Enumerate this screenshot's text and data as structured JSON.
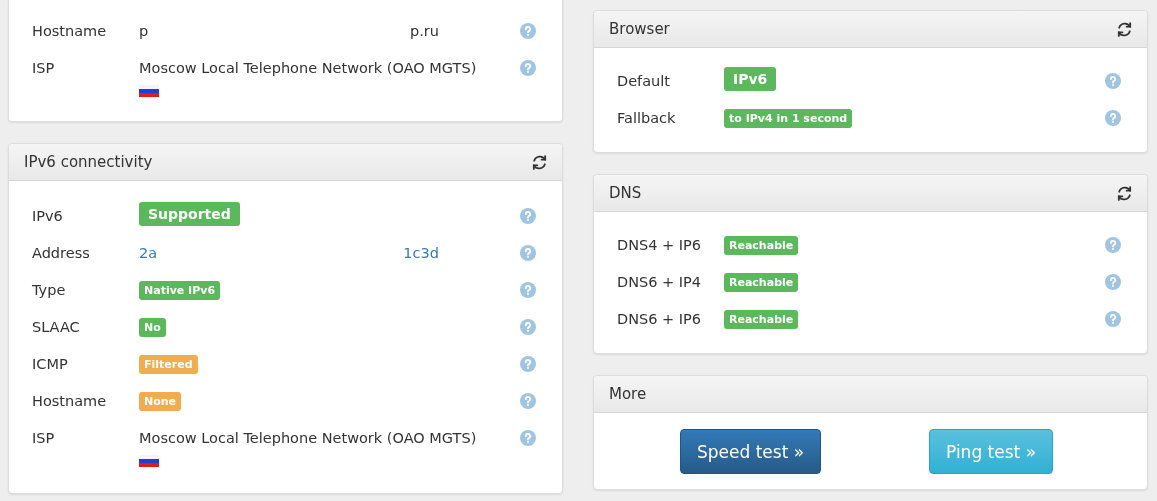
{
  "left": [
    {
      "cut_top": true,
      "rows": [
        {
          "label": "Hostname",
          "kind": "redacted",
          "parts": [
            "p",
            "p.ru"
          ]
        },
        {
          "label": "ISP",
          "kind": "text",
          "value": "Moscow Local Telephone Network (OAO MGTS)",
          "flag": true
        }
      ]
    },
    {
      "title": "IPv6 connectivity",
      "cut_top": false,
      "rows": [
        {
          "label": "IPv6",
          "kind": "large_badge",
          "value": "Supported",
          "color": "#5cb85c"
        },
        {
          "label": "Address",
          "kind": "redacted_link",
          "parts": [
            "2a",
            "1c3d"
          ]
        },
        {
          "label": "Type",
          "kind": "badge",
          "value": "Native IPv6",
          "color": "#5cb85c"
        },
        {
          "label": "SLAAC",
          "kind": "badge",
          "value": "No",
          "color": "#5cb85c"
        },
        {
          "label": "ICMP",
          "kind": "badge",
          "value": "Filtered",
          "color": "#f0ad4e"
        },
        {
          "label": "Hostname",
          "kind": "badge",
          "value": "None",
          "color": "#f0ad4e"
        },
        {
          "label": "ISP",
          "kind": "text",
          "value": "Moscow Local Telephone Network (OAO MGTS)",
          "flag": true
        }
      ]
    }
  ],
  "right": [
    {
      "title": "Browser",
      "cut_top": false,
      "rows": [
        {
          "label": "Default",
          "kind": "large_badge",
          "value": "IPv6",
          "color": "#5cb85c"
        },
        {
          "label": "Fallback",
          "kind": "badge",
          "value": "to IPv4 in 1 second",
          "color": "#5cb85c"
        }
      ]
    },
    {
      "title": "DNS",
      "cut_top": false,
      "rows": [
        {
          "label": "DNS4 + IP6",
          "kind": "badge",
          "value": "Reachable",
          "color": "#5cb85c"
        },
        {
          "label": "DNS6 + IP4",
          "kind": "badge",
          "value": "Reachable",
          "color": "#5cb85c"
        },
        {
          "label": "DNS6 + IP6",
          "kind": "badge",
          "value": "Reachable",
          "color": "#5cb85c"
        }
      ]
    }
  ],
  "more": {
    "title": "More",
    "buttons": [
      {
        "label": "Speed test »",
        "kind": "primary"
      },
      {
        "label": "Ping test »",
        "kind": "info"
      }
    ]
  }
}
